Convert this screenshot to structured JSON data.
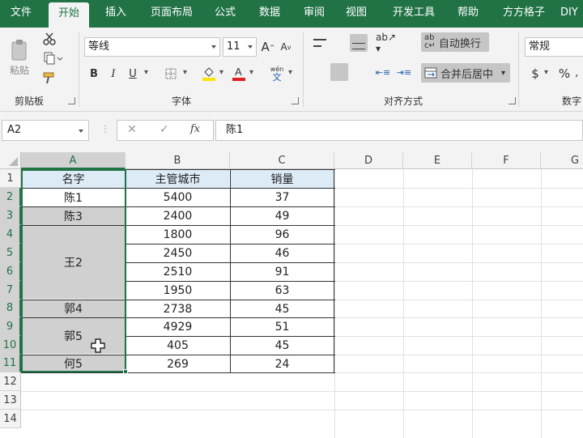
{
  "ribbon_tabs": [
    "文件",
    "开始",
    "插入",
    "页面布局",
    "公式",
    "数据",
    "审阅",
    "视图",
    "开发工具",
    "帮助",
    "方方格子",
    "DIY"
  ],
  "active_tab": "开始",
  "ribbon": {
    "clipboard": {
      "paste_label": "粘贴",
      "group_label": "剪贴板"
    },
    "font": {
      "font_name": "等线",
      "font_size": "11",
      "group_label": "字体",
      "bold": "B",
      "italic": "I",
      "underline": "U",
      "grow_font": "A",
      "shrink_font": "A",
      "phonetic_top": "wén",
      "phonetic_bottom": "文"
    },
    "alignment": {
      "wrap_text": "自动换行",
      "merge_center": "合并后居中",
      "group_label": "对齐方式"
    },
    "number": {
      "format": "常规",
      "group_label": "数字",
      "currency": "$",
      "percent": "%"
    }
  },
  "formula_bar": {
    "name_box": "A2",
    "fx": "fx",
    "content": "陈1"
  },
  "columns": [
    "A",
    "B",
    "C",
    "D",
    "E",
    "F",
    "G"
  ],
  "rows": [
    "1",
    "2",
    "3",
    "4",
    "5",
    "6",
    "7",
    "8",
    "9",
    "10",
    "11",
    "12",
    "13",
    "14"
  ],
  "selected_column": "A",
  "table": {
    "headers": [
      "名字",
      "主管城市",
      "销量"
    ],
    "names": [
      "陈1",
      "陈3",
      "王2",
      "郭4",
      "郭5",
      "何5"
    ],
    "cities": [
      "5400",
      "2400",
      "1800",
      "2450",
      "2510",
      "1950",
      "2738",
      "4929",
      "405",
      "269"
    ],
    "sales": [
      "37",
      "49",
      "96",
      "46",
      "91",
      "63",
      "45",
      "51",
      "45",
      "24"
    ]
  },
  "colors": {
    "brand_green": "#217346",
    "header_fill": "#ddebf7",
    "selection_fill": "#d0d0d0",
    "font_color_red": "#e02020",
    "highlight_yellow": "#ffe400"
  }
}
